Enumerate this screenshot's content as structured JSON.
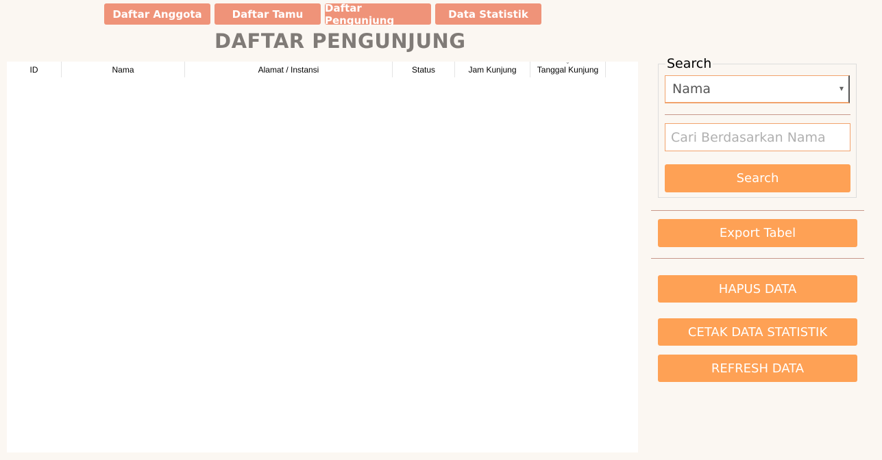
{
  "nav": {
    "items": [
      {
        "label": "Daftar Anggota"
      },
      {
        "label": "Daftar Tamu"
      },
      {
        "label": "Daftar Pengunjung"
      },
      {
        "label": "Data Statistik"
      }
    ]
  },
  "page": {
    "title": "DAFTAR PENGUNJUNG"
  },
  "table": {
    "columns": [
      {
        "label": "ID"
      },
      {
        "label": "Nama"
      },
      {
        "label": "Alamat / Instansi"
      },
      {
        "label": "Status"
      },
      {
        "label": "Jam Kunjung"
      },
      {
        "label": "Tanggal Kunjung"
      }
    ],
    "rows": []
  },
  "search": {
    "legend": "Search",
    "combo_value": "Nama",
    "placeholder": "Cari Berdasarkan Nama",
    "button_label": "Search"
  },
  "actions": {
    "export": "Export Tabel",
    "delete": "HAPUS DATA",
    "print_stats": "CETAK DATA STATISTIK",
    "refresh": "REFRESH DATA"
  },
  "colors": {
    "nav_button": "#ef9379",
    "action_button": "#fea155",
    "background": "#fbf7f2"
  }
}
